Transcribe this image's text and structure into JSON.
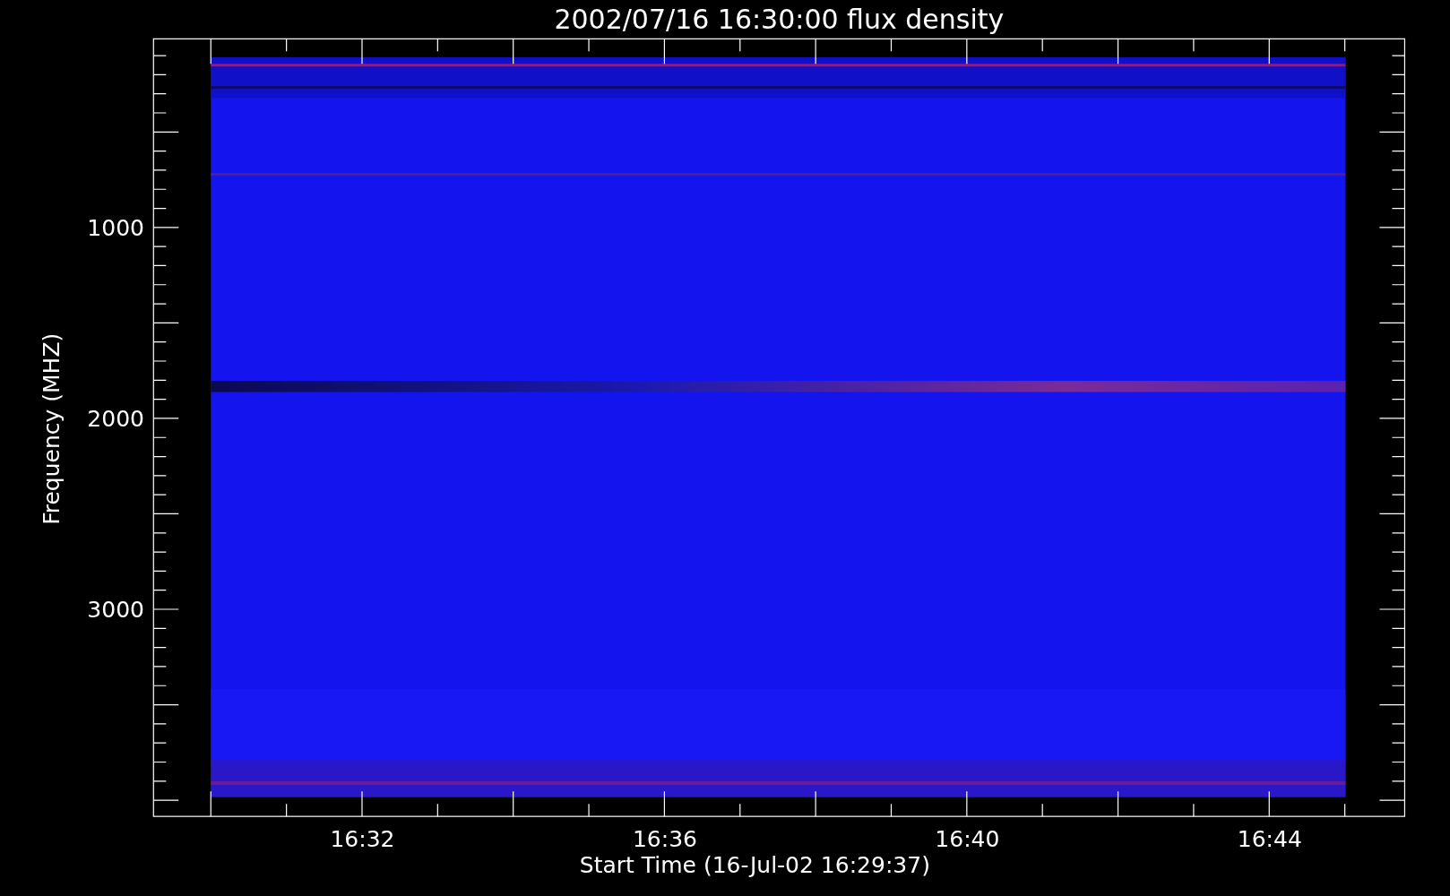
{
  "plot": {
    "title": "2002/07/16 16:30:00 flux density",
    "x_axis": {
      "label": "Start Time (16-Jul-02 16:29:37)",
      "ticks": [
        "16:32",
        "16:36",
        "16:40",
        "16:44"
      ]
    },
    "y_axis": {
      "label": "Frequency (MHZ)",
      "ticks": [
        "1000",
        "2000",
        "3000"
      ]
    }
  }
}
